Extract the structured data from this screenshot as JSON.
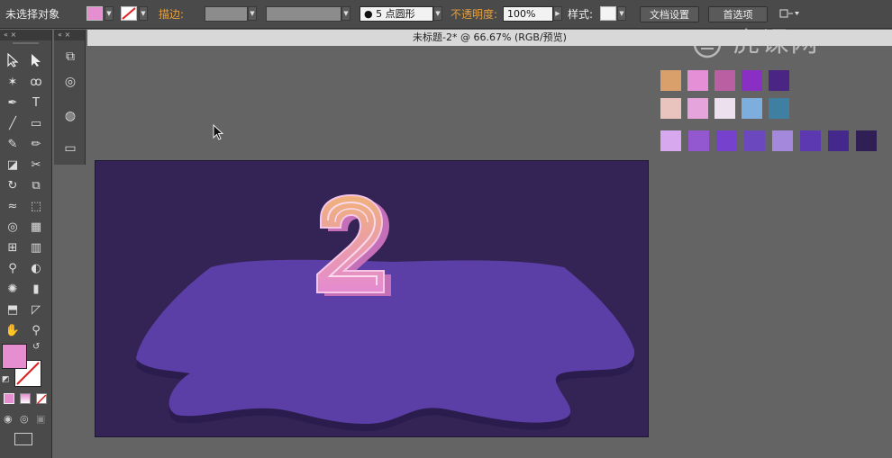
{
  "control_bar": {
    "selection_status": "未选择对象",
    "stroke_label": "描边:",
    "brush_label": "5 点圆形",
    "opacity_label": "不透明度:",
    "opacity_value": "100%",
    "style_label": "样式:",
    "doc_setup_button": "文档设置",
    "preferences_button": "首选项",
    "fill_color": "#e58fd0"
  },
  "document": {
    "tab_title": "未标题-2* @ 66.67% (RGB/预览)"
  },
  "tools_panel": {
    "header": "« ×",
    "subpanel_header": "« ×",
    "fill_color": "#e58fd0",
    "tools": [
      "selection-tool",
      "direct-selection-tool",
      "magic-wand-tool",
      "lasso-tool",
      "pen-tool",
      "type-tool",
      "line-tool",
      "rectangle-tool",
      "paintbrush-tool",
      "pencil-tool",
      "eraser-tool",
      "scissors-tool",
      "rotate-tool",
      "scale-tool",
      "warp-tool",
      "free-transform-tool",
      "shape-builder-tool",
      "perspective-grid-tool",
      "mesh-tool",
      "gradient-tool",
      "eyedropper-tool",
      "blend-tool",
      "symbol-sprayer-tool",
      "column-graph-tool",
      "artboard-tool",
      "slice-tool",
      "hand-tool",
      "zoom-tool"
    ]
  },
  "artwork": {
    "digit": "2",
    "background_color": "#332455",
    "island_color": "#5b3fa6"
  },
  "palette": {
    "row1": [
      "#d9a06c",
      "#e48fd6",
      "#bb5fa3",
      "#8a2fc4",
      "#4b2583"
    ],
    "row2": [
      "#e9c3bd",
      "#e6a4dc",
      "#ece0ee",
      "#7daede",
      "#3f7fa2"
    ],
    "row3": [
      "#d8a8ee",
      "#9357d0",
      "#7541cd",
      "#6b48bd",
      "#a488dc",
      "#5d39b1",
      "#44288c",
      "#2f1f55"
    ]
  },
  "watermark": "虎课网"
}
